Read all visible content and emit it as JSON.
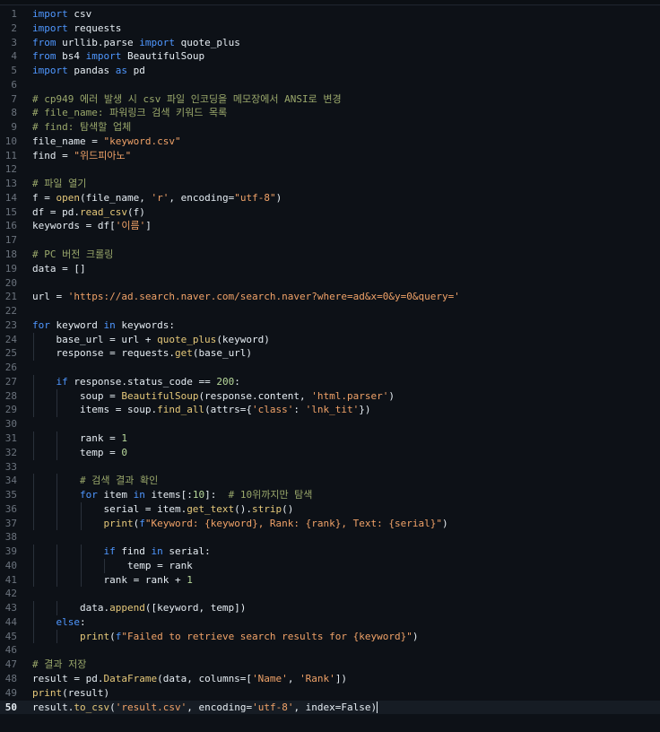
{
  "editor": {
    "current_line": 50,
    "lines": [
      {
        "n": 1,
        "text": "import csv"
      },
      {
        "n": 2,
        "text": "import requests"
      },
      {
        "n": 3,
        "text": "from urllib.parse import quote_plus"
      },
      {
        "n": 4,
        "text": "from bs4 import BeautifulSoup"
      },
      {
        "n": 5,
        "text": "import pandas as pd"
      },
      {
        "n": 6,
        "text": ""
      },
      {
        "n": 7,
        "text": "# cp949 에러 발생 시 csv 파일 인코딩을 메모장에서 ANSI로 변경"
      },
      {
        "n": 8,
        "text": "# file_name: 파워링크 검색 키워드 목록"
      },
      {
        "n": 9,
        "text": "# find: 탐색할 업체"
      },
      {
        "n": 10,
        "text": "file_name = \"keyword.csv\""
      },
      {
        "n": 11,
        "text": "find = \"위드피아노\""
      },
      {
        "n": 12,
        "text": ""
      },
      {
        "n": 13,
        "text": "# 파일 열기"
      },
      {
        "n": 14,
        "text": "f = open(file_name, 'r', encoding=\"utf-8\")"
      },
      {
        "n": 15,
        "text": "df = pd.read_csv(f)"
      },
      {
        "n": 16,
        "text": "keywords = df['이름']"
      },
      {
        "n": 17,
        "text": ""
      },
      {
        "n": 18,
        "text": "# PC 버전 크롤링"
      },
      {
        "n": 19,
        "text": "data = []"
      },
      {
        "n": 20,
        "text": ""
      },
      {
        "n": 21,
        "text": "url = 'https://ad.search.naver.com/search.naver?where=ad&x=0&y=0&query='"
      },
      {
        "n": 22,
        "text": ""
      },
      {
        "n": 23,
        "text": "for keyword in keywords:"
      },
      {
        "n": 24,
        "text": "    base_url = url + quote_plus(keyword)"
      },
      {
        "n": 25,
        "text": "    response = requests.get(base_url)"
      },
      {
        "n": 26,
        "text": ""
      },
      {
        "n": 27,
        "text": "    if response.status_code == 200:"
      },
      {
        "n": 28,
        "text": "        soup = BeautifulSoup(response.content, 'html.parser')"
      },
      {
        "n": 29,
        "text": "        items = soup.find_all(attrs={'class': 'lnk_tit'})"
      },
      {
        "n": 30,
        "text": ""
      },
      {
        "n": 31,
        "text": "        rank = 1"
      },
      {
        "n": 32,
        "text": "        temp = 0"
      },
      {
        "n": 33,
        "text": ""
      },
      {
        "n": 34,
        "text": "        # 검색 결과 확인"
      },
      {
        "n": 35,
        "text": "        for item in items[:10]:  # 10위까지만 탐색"
      },
      {
        "n": 36,
        "text": "            serial = item.get_text().strip()"
      },
      {
        "n": 37,
        "text": "            print(f\"Keyword: {keyword}, Rank: {rank}, Text: {serial}\")"
      },
      {
        "n": 38,
        "text": ""
      },
      {
        "n": 39,
        "text": "            if find in serial:"
      },
      {
        "n": 40,
        "text": "                temp = rank"
      },
      {
        "n": 41,
        "text": "            rank = rank + 1"
      },
      {
        "n": 42,
        "text": ""
      },
      {
        "n": 43,
        "text": "        data.append([keyword, temp])"
      },
      {
        "n": 44,
        "text": "    else:"
      },
      {
        "n": 45,
        "text": "        print(f\"Failed to retrieve search results for {keyword}\")"
      },
      {
        "n": 46,
        "text": ""
      },
      {
        "n": 47,
        "text": "# 결과 저장"
      },
      {
        "n": 48,
        "text": "result = pd.DataFrame(data, columns=['Name', 'Rank'])"
      },
      {
        "n": 49,
        "text": "print(result)"
      },
      {
        "n": 50,
        "text": "result.to_csv('result.csv', encoding='utf-8', index=False)"
      }
    ]
  }
}
